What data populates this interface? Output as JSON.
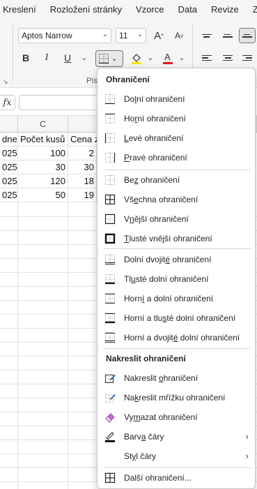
{
  "ribbon_tabs": [
    "Kreslení",
    "Rozložení stránky",
    "Vzorce",
    "Data",
    "Revize",
    "Zo"
  ],
  "font": {
    "name": "Aptos Narrow",
    "size": "11"
  },
  "ribbon_group_label": "Písmo",
  "buttons": {
    "bold": "B",
    "italic": "I",
    "underline": "U"
  },
  "colors": {
    "highlight": "#ffe600",
    "font_color": "#e81123"
  },
  "formula_bar": {
    "fx": "fx",
    "value": ""
  },
  "columns": [
    {
      "header": ""
    },
    {
      "header": "C"
    },
    {
      "header": ""
    }
  ],
  "rows": [
    [
      "dne",
      "Počet kusů",
      "Cena z"
    ],
    [
      "025",
      "100",
      "2"
    ],
    [
      "025",
      "30",
      "30"
    ],
    [
      "025",
      "120",
      "18"
    ],
    [
      "025",
      "50",
      "19"
    ]
  ],
  "menu": {
    "section1_title": "Ohraničení",
    "borders": [
      {
        "pre": "Do",
        "key": "l",
        "post": "ní ohraničení",
        "icon": "bottom-border-icon"
      },
      {
        "pre": "Ho",
        "key": "r",
        "post": "ní ohraničení",
        "icon": "top-border-icon"
      },
      {
        "pre": "",
        "key": "L",
        "post": "evé ohraničení",
        "icon": "left-border-icon"
      },
      {
        "pre": "",
        "key": "P",
        "post": "ravé ohraničení",
        "icon": "right-border-icon"
      },
      {
        "pre": "Be",
        "key": "z",
        "post": " ohraničení",
        "icon": "no-border-icon"
      },
      {
        "pre": "Vš",
        "key": "e",
        "post": "chna ohraničení",
        "icon": "all-borders-icon"
      },
      {
        "pre": "V",
        "key": "n",
        "post": "ější ohraničení",
        "icon": "outside-borders-icon"
      },
      {
        "pre": "",
        "key": "T",
        "post": "lusté vnější ohraničení",
        "icon": "thick-outside-borders-icon"
      },
      {
        "pre": "Dolní dvojit",
        "key": "é",
        "post": " ohraničení",
        "icon": "bottom-double-border-icon"
      },
      {
        "pre": "Tl",
        "key": "u",
        "post": "sté dolní ohraničení",
        "icon": "thick-bottom-border-icon"
      },
      {
        "pre": "Horn",
        "key": "í",
        "post": " a dolní ohraničení",
        "icon": "top-bottom-border-icon"
      },
      {
        "pre": "Horní a tlu",
        "key": "s",
        "post": "té dolní ohraničení",
        "icon": "top-thick-bottom-border-icon"
      },
      {
        "pre": "Horní a dvojit",
        "key": "é",
        "post": " dolní ohraničení",
        "icon": "top-double-bottom-border-icon"
      }
    ],
    "section2_title": "Nakreslit ohraničení",
    "draw": [
      {
        "pre": "Nakreslit ",
        "key": "o",
        "post": "hraničení",
        "icon": "draw-border-icon"
      },
      {
        "pre": "Na",
        "key": "k",
        "post": "reslit mřížku ohraničení",
        "icon": "draw-border-grid-icon"
      },
      {
        "pre": "Vy",
        "key": "m",
        "post": "azat ohraničení",
        "icon": "eraser-icon"
      },
      {
        "pre": "Barv",
        "key": "a",
        "post": " čáry",
        "icon": "line-color-icon",
        "submenu": true
      },
      {
        "pre": "St",
        "key": "y",
        "post": "l čáry",
        "icon": "",
        "submenu": true
      },
      {
        "pre": "Další ohraničení",
        "key": "",
        "post": "...",
        "icon": "more-borders-icon"
      }
    ]
  }
}
